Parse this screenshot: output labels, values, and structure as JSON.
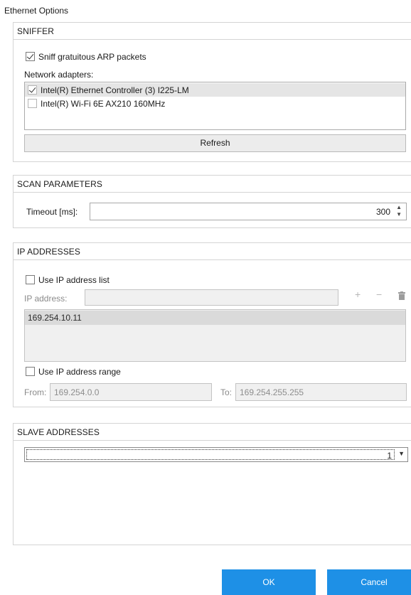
{
  "window": {
    "title": "Ethernet Options"
  },
  "sniffer": {
    "header": "SNIFFER",
    "sniff_checkbox_label": "Sniff gratuitous ARP packets",
    "sniff_checked": true,
    "adapters_label": "Network adapters:",
    "adapters": [
      {
        "label": "Intel(R) Ethernet Controller (3) I225-LM",
        "checked": true,
        "selected": true
      },
      {
        "label": "Intel(R) Wi-Fi 6E AX210 160MHz",
        "checked": false,
        "selected": false
      }
    ],
    "refresh_label": "Refresh"
  },
  "scan": {
    "header": "SCAN PARAMETERS",
    "timeout_label": "Timeout [ms]:",
    "timeout_value": "300"
  },
  "ip": {
    "header": "IP ADDRESSES",
    "use_list_label": "Use IP address list",
    "use_list_checked": false,
    "ip_label": "IP address:",
    "ip_value": "",
    "list": [
      "169.254.10.11"
    ],
    "use_range_label": "Use IP address range",
    "use_range_checked": false,
    "from_label": "From:",
    "from_value": "169.254.0.0",
    "to_label": "To:",
    "to_value": "169.254.255.255"
  },
  "slave": {
    "header": "SLAVE ADDRESSES",
    "selected_value": "1"
  },
  "buttons": {
    "ok": "OK",
    "cancel": "Cancel"
  },
  "colors": {
    "primary_button": "#1e90e6",
    "selection": "#e5e5e5"
  }
}
